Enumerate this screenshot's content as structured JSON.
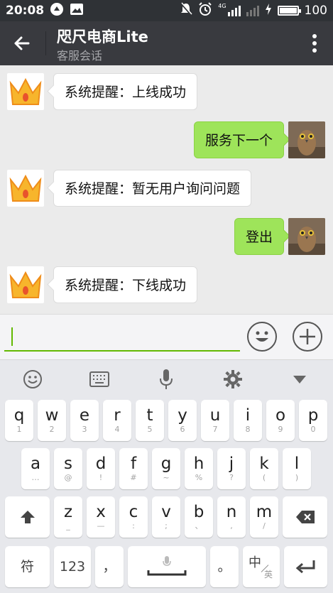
{
  "status_bar": {
    "time": "20:08",
    "network": "4G",
    "battery": "100",
    "battery_level": 1.0
  },
  "header": {
    "title": "咫尺电商Lite",
    "subtitle": "客服会话"
  },
  "messages": [
    {
      "side": "left",
      "avatar": "crown-avatar",
      "text": "系统提醒：上线成功"
    },
    {
      "side": "right",
      "avatar": "owl-avatar",
      "text": "服务下一个"
    },
    {
      "side": "left",
      "avatar": "crown-avatar",
      "text": "系统提醒：暂无用户询问问题"
    },
    {
      "side": "right",
      "avatar": "owl-avatar",
      "text": "登出"
    },
    {
      "side": "left",
      "avatar": "crown-avatar",
      "text": "系统提醒：下线成功"
    }
  ],
  "input": {
    "value": ""
  },
  "keyboard": {
    "rows": [
      [
        {
          "k": "q",
          "s": "1"
        },
        {
          "k": "w",
          "s": "2"
        },
        {
          "k": "e",
          "s": "3"
        },
        {
          "k": "r",
          "s": "4"
        },
        {
          "k": "t",
          "s": "5"
        },
        {
          "k": "y",
          "s": "6"
        },
        {
          "k": "u",
          "s": "7"
        },
        {
          "k": "i",
          "s": "8"
        },
        {
          "k": "o",
          "s": "9"
        },
        {
          "k": "p",
          "s": "0"
        }
      ],
      [
        {
          "k": "a",
          "s": "…"
        },
        {
          "k": "s",
          "s": "@"
        },
        {
          "k": "d",
          "s": "!"
        },
        {
          "k": "f",
          "s": "#"
        },
        {
          "k": "g",
          "s": "~"
        },
        {
          "k": "h",
          "s": "%"
        },
        {
          "k": "j",
          "s": "?"
        },
        {
          "k": "k",
          "s": "("
        },
        {
          "k": "l",
          "s": ")"
        }
      ],
      [
        {
          "k": "z",
          "s": "_"
        },
        {
          "k": "x",
          "s": "—"
        },
        {
          "k": "c",
          "s": ":"
        },
        {
          "k": "v",
          "s": ";"
        },
        {
          "k": "b",
          "s": "、"
        },
        {
          "k": "n",
          "s": ","
        },
        {
          "k": "m",
          "s": "/"
        }
      ]
    ],
    "symbol_key": "符",
    "number_key": "123",
    "comma_key": "，",
    "period_key": "。",
    "lang_key_main": "中",
    "lang_key_sub": "英"
  }
}
